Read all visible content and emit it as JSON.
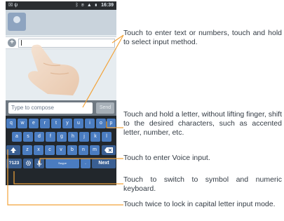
{
  "status_bar": {
    "left": "☒ ψ",
    "icons": "ᛒ ◉ ▲ ▮",
    "time": "16:39"
  },
  "composer": {
    "placeholder": "Type to compose",
    "send_label": "Send"
  },
  "keyboard": {
    "row1": [
      "q",
      "w",
      "e",
      "r",
      "t",
      "y",
      "u",
      "i",
      "o",
      "p"
    ],
    "row2": [
      "a",
      "s",
      "d",
      "f",
      "g",
      "h",
      "j",
      "k",
      "l"
    ],
    "row3": [
      "z",
      "x",
      "c",
      "v",
      "b",
      "n",
      "m"
    ],
    "shift_icon": "shift-arrow-icon",
    "delete_icon": "backspace-icon",
    "sym_label": "?123",
    "settings_icon": "gear-icon",
    "mic_icon": "microphone-icon",
    "space_label": "Swype",
    "period_label": ".",
    "next_label": "Next"
  },
  "callouts": {
    "input": "Touch to enter text or numbers, touch and hold to select input method.",
    "letter": "Touch and hold a letter, without lifting finger, shift to the desired characters, such as accented letter, number, etc.",
    "voice": "Touch to enter Voice input.",
    "symbol": "Touch to switch to symbol and numeric keyboard.",
    "caps": "Touch twice to lock in capital letter input mode."
  },
  "colors": {
    "key": "#4a7cc0",
    "keyboard_bg": "#22272c",
    "line": "#f2a33a",
    "text": "#333b44"
  }
}
